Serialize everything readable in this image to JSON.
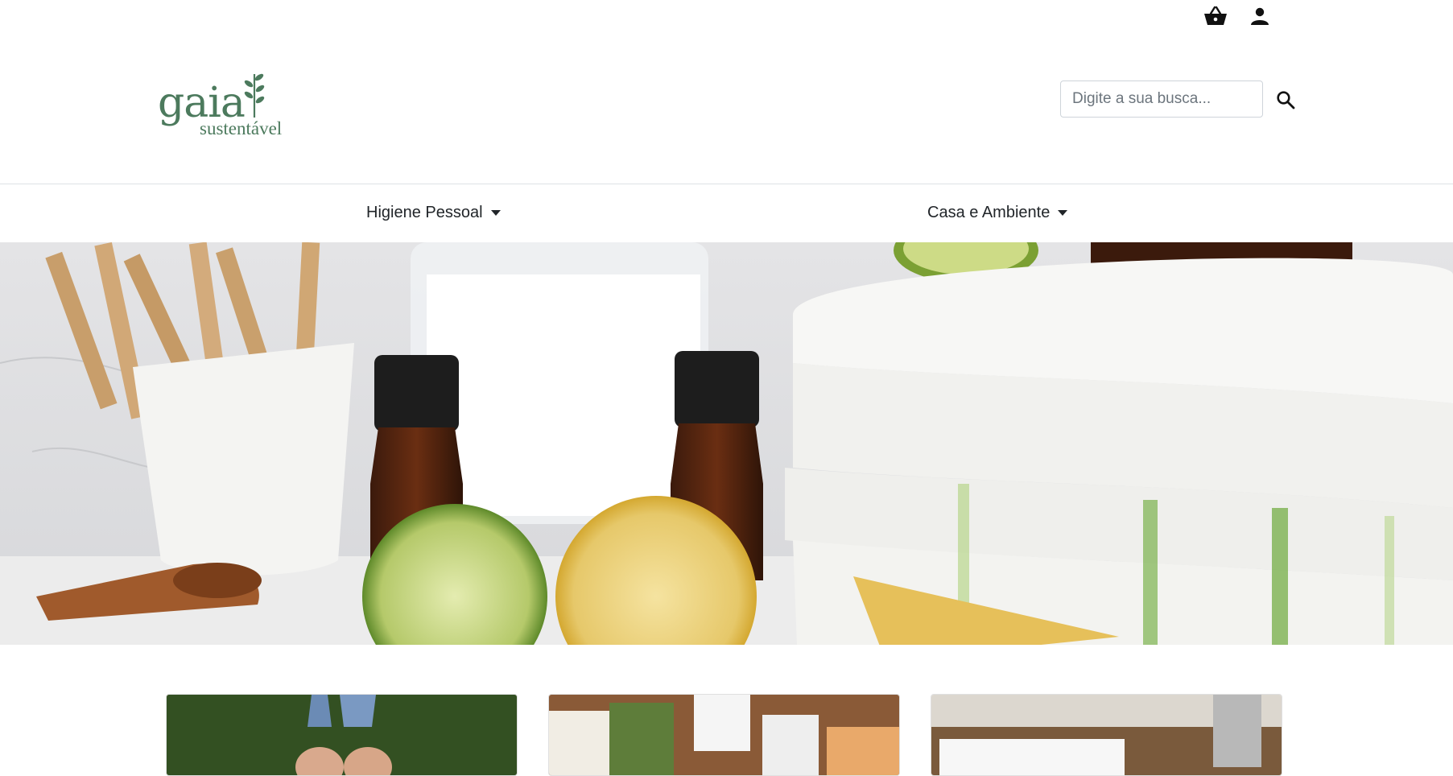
{
  "brand": {
    "name": "gaia",
    "tagline": "sustentável",
    "color": "#4c7a5d"
  },
  "topbar": {
    "icons": [
      "shopping-basket-icon",
      "user-icon"
    ]
  },
  "search": {
    "placeholder": "Digite a sua busca..."
  },
  "nav": {
    "items": [
      {
        "label": "Higiene Pessoal"
      },
      {
        "label": "Casa e Ambiente"
      }
    ]
  },
  "hero": {
    "subject": "towels, lemons, essential oil bottles, clothespins"
  },
  "cards": [
    {
      "name": "card-1"
    },
    {
      "name": "card-2"
    },
    {
      "name": "card-3"
    }
  ]
}
